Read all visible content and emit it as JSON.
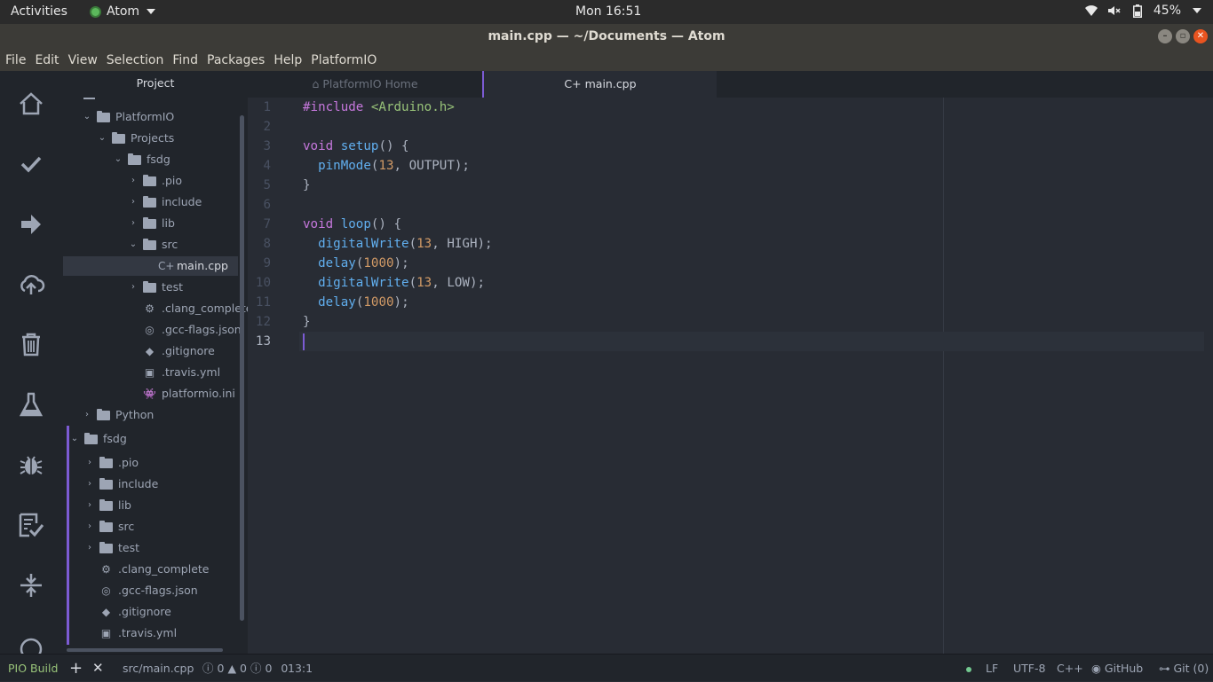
{
  "topbar": {
    "activities": "Activities",
    "app_name": "Atom",
    "clock": "Mon 16:51",
    "battery": "45%",
    "icons": [
      "wifi-icon",
      "mute-icon",
      "battery-icon",
      "power-menu-caret-icon"
    ]
  },
  "window": {
    "title": "main.cpp — ~/Documents — Atom"
  },
  "menu": [
    "File",
    "Edit",
    "View",
    "Selection",
    "Find",
    "Packages",
    "Help",
    "PlatformIO"
  ],
  "pio_sidebar": [
    "home-icon",
    "build-check-icon",
    "upload-arrow-icon",
    "cloud-upload-icon",
    "trash-icon",
    "test-flask-icon",
    "debug-bug-icon",
    "tasks-checklist-icon",
    "serial-monitor-icon"
  ],
  "tree": {
    "header": "Project",
    "items": [
      {
        "label": "PlatformIO",
        "type": "folder",
        "open": true
      },
      {
        "label": "Projects",
        "type": "folder",
        "open": true
      },
      {
        "label": "fsdg",
        "type": "folder",
        "open": true
      },
      {
        "label": ".pio",
        "type": "folder",
        "open": false
      },
      {
        "label": "include",
        "type": "folder",
        "open": false
      },
      {
        "label": "lib",
        "type": "folder",
        "open": false
      },
      {
        "label": "src",
        "type": "folder",
        "open": true
      },
      {
        "label": "main.cpp",
        "type": "file"
      },
      {
        "label": "test",
        "type": "folder",
        "open": false
      },
      {
        "label": ".clang_complete",
        "type": "file"
      },
      {
        "label": ".gcc-flags.json",
        "type": "file"
      },
      {
        "label": ".gitignore",
        "type": "file"
      },
      {
        "label": ".travis.yml",
        "type": "file"
      },
      {
        "label": "platformio.ini",
        "type": "file"
      },
      {
        "label": "Python",
        "type": "folder",
        "open": false
      },
      {
        "label": "fsdg",
        "type": "folder",
        "open": true
      },
      {
        "label": ".pio",
        "type": "folder",
        "open": false
      },
      {
        "label": "include",
        "type": "folder",
        "open": false
      },
      {
        "label": "lib",
        "type": "folder",
        "open": false
      },
      {
        "label": "src",
        "type": "folder",
        "open": false
      },
      {
        "label": "test",
        "type": "folder",
        "open": false
      },
      {
        "label": ".clang_complete",
        "type": "file"
      },
      {
        "label": ".gcc-flags.json",
        "type": "file"
      },
      {
        "label": ".gitignore",
        "type": "file"
      },
      {
        "label": ".travis.yml",
        "type": "file"
      }
    ]
  },
  "tabs": [
    {
      "label": "PlatformIO Home"
    },
    {
      "label": "main.cpp"
    }
  ],
  "editor": {
    "line_numbers": [
      "1",
      "2",
      "3",
      "4",
      "5",
      "6",
      "7",
      "8",
      "9",
      "10",
      "11",
      "12",
      "13"
    ],
    "lines": [
      "#include <Arduino.h>",
      "",
      "void setup() {",
      "  pinMode(13, OUTPUT);",
      "}",
      "",
      "void loop() {",
      "  digitalWrite(13, HIGH);",
      "  delay(1000);",
      "  digitalWrite(13, LOW);",
      "  delay(1000);",
      "}",
      ""
    ]
  },
  "status": {
    "pio_build": "PIO Build",
    "file_path": "src/main.cpp",
    "errors": "0",
    "warnings": "0",
    "infos": "0",
    "extra": "0",
    "cursor": "13:1",
    "line_ending": "LF",
    "encoding": "UTF-8",
    "grammar": "C++",
    "github": "GitHub",
    "git": "Git (0)"
  }
}
